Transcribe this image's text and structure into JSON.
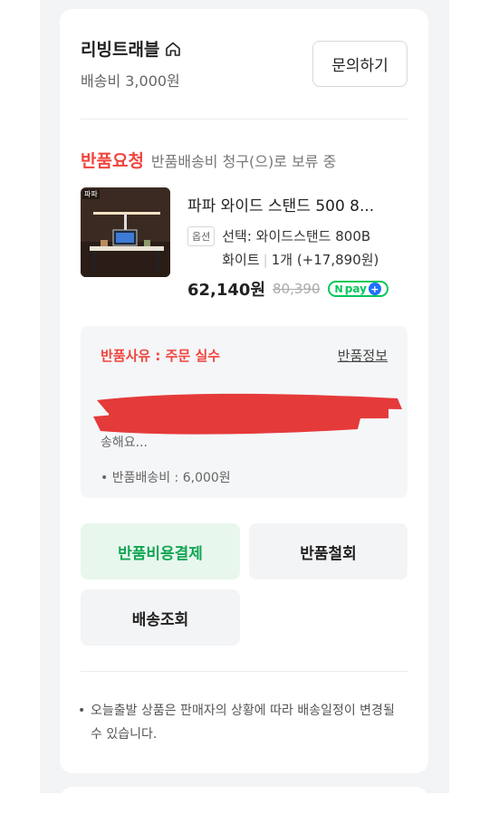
{
  "store": {
    "name": "리빙트래블",
    "shipping_fee": "배송비 3,000원",
    "inquiry_label": "문의하기"
  },
  "status": {
    "title": "반품요청",
    "subtitle": "반품배송비 청구(으)로 보류 중"
  },
  "product": {
    "name": "파파 와이드 스탠드 500 8...",
    "thumb_tag": "파파",
    "option_badge": "옵션",
    "option_line1": "선택: 와이드스탠드 800B",
    "option_color": "화이트",
    "option_qty": "1개 (+17,890원)",
    "price": "62,140원",
    "original_price": "80,390",
    "npay_label": "pay"
  },
  "return_info": {
    "reason_title": "반품사유 : 주문 실수",
    "info_link": "반품정보",
    "description_tail": "송해요...",
    "fee_text": "• 반품배송비 : 6,000원"
  },
  "actions": {
    "pay_label": "반품비용결제",
    "withdraw_label": "반품철회",
    "track_label": "배송조회"
  },
  "notice": {
    "text": "오늘출발 상품은 판매자의 상황에 따라 배송일정이 변경될 수 있습니다."
  },
  "colors": {
    "accent_red": "#f0443d",
    "accent_green": "#13a654",
    "npay_green": "#03c75a"
  }
}
